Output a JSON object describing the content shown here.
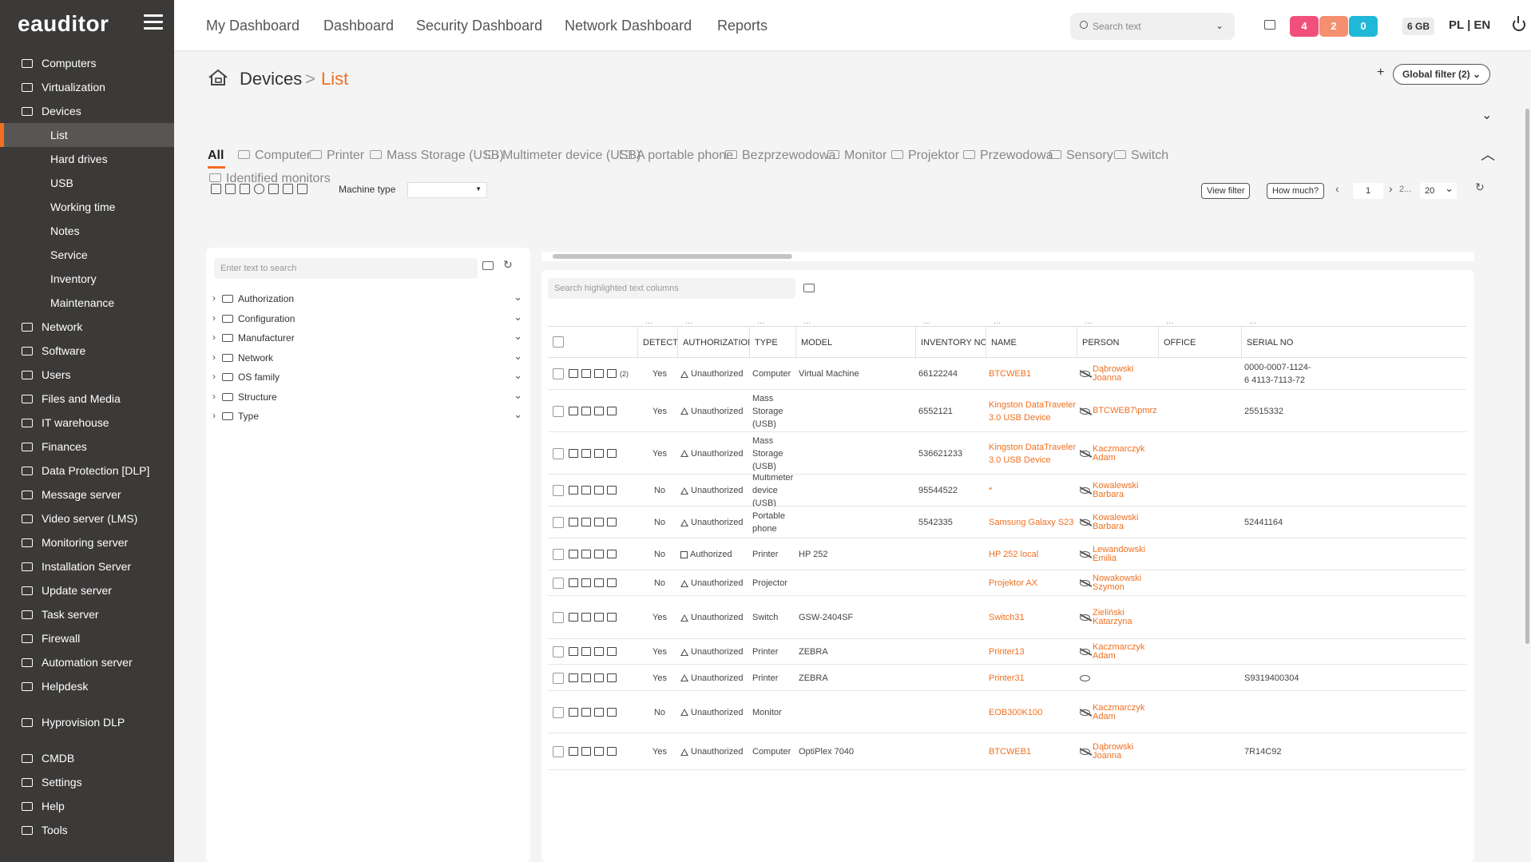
{
  "app": {
    "logo": "eauditor"
  },
  "sidebar": {
    "items": [
      {
        "label": "Computers",
        "icon": "monitor-icon",
        "sub": false,
        "active": false
      },
      {
        "label": "Virtualization",
        "icon": "server-icon",
        "sub": false,
        "active": false
      },
      {
        "label": "Devices",
        "icon": "devices-icon",
        "sub": false,
        "active": false
      },
      {
        "label": "List",
        "icon": "",
        "sub": true,
        "active": true
      },
      {
        "label": "Hard drives",
        "icon": "",
        "sub": true,
        "active": false
      },
      {
        "label": "USB",
        "icon": "",
        "sub": true,
        "active": false
      },
      {
        "label": "Working time",
        "icon": "",
        "sub": true,
        "active": false
      },
      {
        "label": "Notes",
        "icon": "",
        "sub": true,
        "active": false
      },
      {
        "label": "Service",
        "icon": "",
        "sub": true,
        "active": false
      },
      {
        "label": "Inventory",
        "icon": "",
        "sub": true,
        "active": false
      },
      {
        "label": "Maintenance",
        "icon": "",
        "sub": true,
        "active": false
      },
      {
        "label": "Network",
        "icon": "network-icon",
        "sub": false,
        "active": false
      },
      {
        "label": "Software",
        "icon": "software-icon",
        "sub": false,
        "active": false
      },
      {
        "label": "Users",
        "icon": "users-icon",
        "sub": false,
        "active": false
      },
      {
        "label": "Files and Media",
        "icon": "files-icon",
        "sub": false,
        "active": false
      },
      {
        "label": "IT warehouse",
        "icon": "warehouse-icon",
        "sub": false,
        "active": false
      },
      {
        "label": "Finances",
        "icon": "finances-icon",
        "sub": false,
        "active": false
      },
      {
        "label": "Data Protection [DLP]",
        "icon": "shield-icon",
        "sub": false,
        "active": false
      },
      {
        "label": "Message server",
        "icon": "message-icon",
        "sub": false,
        "active": false
      },
      {
        "label": "Video server (LMS)",
        "icon": "video-icon",
        "sub": false,
        "active": false
      },
      {
        "label": "Monitoring server",
        "icon": "monitoring-icon",
        "sub": false,
        "active": false
      },
      {
        "label": "Installation Server",
        "icon": "installation-icon",
        "sub": false,
        "active": false
      },
      {
        "label": "Update server",
        "icon": "update-icon",
        "sub": false,
        "active": false
      },
      {
        "label": "Task server",
        "icon": "task-icon",
        "sub": false,
        "active": false
      },
      {
        "label": "Firewall",
        "icon": "firewall-icon",
        "sub": false,
        "active": false
      },
      {
        "label": "Automation server",
        "icon": "automation-icon",
        "sub": false,
        "active": false
      },
      {
        "label": "Helpdesk",
        "icon": "helpdesk-icon",
        "sub": false,
        "active": false
      }
    ],
    "items2": [
      {
        "label": "Hyprovision DLP",
        "icon": "hyprovision-icon"
      }
    ],
    "items3": [
      {
        "label": "CMDB",
        "icon": "cmdb-icon"
      },
      {
        "label": "Settings",
        "icon": "gear-icon"
      },
      {
        "label": "Help",
        "icon": "help-icon"
      },
      {
        "label": "Tools",
        "icon": "tools-icon"
      }
    ]
  },
  "topbar": {
    "nav": [
      "My Dashboard",
      "Dashboard",
      "Security Dashboard",
      "Network Dashboard",
      "Reports"
    ],
    "search_placeholder": "Search text",
    "badges": [
      {
        "value": "4",
        "color": "#f0507a"
      },
      {
        "value": "2",
        "color": "#f49070"
      },
      {
        "value": "0",
        "color": "#20b8d8"
      }
    ],
    "memory": "6 GB",
    "lang": "PL | EN"
  },
  "breadcrumb": {
    "section": "Devices",
    "separator": ">",
    "current": "List"
  },
  "global_filter": "Global filter (2)",
  "tabs": [
    "All",
    "Computer",
    "Printer",
    "Mass Storage (USB)",
    "Multimeter device (USB)",
    "A portable phone",
    "Bezprzewodowa",
    "Monitor",
    "Projektor",
    "Przewodowa",
    "Sensory",
    "Switch",
    "Identified monitors"
  ],
  "toolbar": {
    "machine_type_label": "Machine type",
    "view_filter": "View filter",
    "how_much": "How much?",
    "page": "1",
    "page_more": "2...",
    "page_size": "20"
  },
  "tree": {
    "search_placeholder": "Enter text to search",
    "items": [
      "Authorization",
      "Configuration",
      "Manufacturer",
      "Network",
      "OS family",
      "Structure",
      "Type"
    ]
  },
  "grid": {
    "search_placeholder": "Search highlighted text columns",
    "columns": [
      "DETECTED",
      "AUTHORIZATION",
      "TYPE",
      "MODEL",
      "INVENTORY NO",
      "NAME",
      "PERSON",
      "OFFICE",
      "SERIAL NO"
    ],
    "rows": [
      {
        "detected": "Yes",
        "auth": "Unauthorized",
        "authorized": false,
        "type": "Computer",
        "model": "Virtual Machine",
        "inv": "66122244",
        "name": "BTCWEB1",
        "person": "Dąbrowski Joanna (BTCDEMO\\Joanna",
        "eye_slash": true,
        "office": "",
        "serial": "0000-0007-1124-6 4113-7113-72",
        "attach": "(2)"
      },
      {
        "detected": "Yes",
        "auth": "Unauthorized",
        "authorized": false,
        "type": "Mass Storage (USB)",
        "model": "",
        "inv": "6552121",
        "name": "Kingston DataTraveler 3.0 USB Device",
        "person": "BTCWEB7\\pmrzygl",
        "eye_slash": true,
        "office": "",
        "serial": "25515332",
        "attach": ""
      },
      {
        "detected": "Yes",
        "auth": "Unauthorized",
        "authorized": false,
        "type": "Mass Storage (USB)",
        "model": "",
        "inv": "536621233",
        "name": "Kingston DataTraveler 3.0 USB Device",
        "person": "Kaczmarczyk Adam (BTCDEMO\\Adam.K",
        "eye_slash": true,
        "office": "",
        "serial": "",
        "attach": ""
      },
      {
        "detected": "No",
        "auth": "Unauthorized",
        "authorized": false,
        "type": "Multimeter device (USB)",
        "model": "",
        "inv": "95544522",
        "name": "*",
        "person": "Kowalewski Barbara (BTCDEMO\\Barbara",
        "eye_slash": true,
        "office": "",
        "serial": "",
        "attach": ""
      },
      {
        "detected": "No",
        "auth": "Unauthorized",
        "authorized": false,
        "type": "Portable phone",
        "model": "",
        "inv": "5542335",
        "name": "Samsung Galaxy S23",
        "person": "Kowalewski Barbara (BTCDEMO\\Barbara",
        "eye_slash": true,
        "office": "",
        "serial": "52441164",
        "attach": ""
      },
      {
        "detected": "No",
        "auth": "Authorized",
        "authorized": true,
        "type": "Printer",
        "model": "HP 252",
        "inv": "",
        "name": "HP 252 local",
        "person": "Lewandowski Emilia (BTCDEMO\\Emilia.L",
        "eye_slash": true,
        "office": "",
        "serial": "",
        "attach": ""
      },
      {
        "detected": "No",
        "auth": "Unauthorized",
        "authorized": false,
        "type": "Projector",
        "model": "",
        "inv": "",
        "name": "Projektor AX",
        "person": "Nowakowski Szymon (BTCDEMO\\Szymon",
        "eye_slash": true,
        "office": "",
        "serial": "",
        "attach": ""
      },
      {
        "detected": "Yes",
        "auth": "Unauthorized",
        "authorized": false,
        "type": "Switch",
        "model": "GSW-2404SF",
        "inv": "",
        "name": "Switch31",
        "person": "Zieliński Katarzyna (BTCDEMO\\Katarzy",
        "eye_slash": true,
        "office": "",
        "serial": "",
        "attach": ""
      },
      {
        "detected": "Yes",
        "auth": "Unauthorized",
        "authorized": false,
        "type": "Printer",
        "model": "ZEBRA",
        "inv": "",
        "name": "Printer13",
        "person": "Kaczmarczyk Adam (BTCDEMO\\Adam.K",
        "eye_slash": true,
        "office": "",
        "serial": "",
        "attach": ""
      },
      {
        "detected": "Yes",
        "auth": "Unauthorized",
        "authorized": false,
        "type": "Printer",
        "model": "ZEBRA",
        "inv": "",
        "name": "Printer31",
        "person": "",
        "eye_slash": false,
        "office": "",
        "serial": "S9319400304",
        "attach": ""
      },
      {
        "detected": "No",
        "auth": "Unauthorized",
        "authorized": false,
        "type": "Monitor",
        "model": "",
        "inv": "",
        "name": "EOB300K100",
        "person": "Kaczmarczyk Adam (BTCDEMO\\Adam.K",
        "eye_slash": true,
        "office": "",
        "serial": "",
        "attach": ""
      },
      {
        "detected": "Yes",
        "auth": "Unauthorized",
        "authorized": false,
        "type": "Computer",
        "model": "OptiPlex 7040",
        "inv": "",
        "name": "BTCWEB1",
        "person": "Dąbrowski Joanna (BTCDEMO\\Joanna",
        "eye_slash": true,
        "office": "",
        "serial": "7R14C92",
        "attach": ""
      }
    ]
  },
  "colors": {
    "accent": "#f07020",
    "sidebar": "#3c3a38"
  }
}
